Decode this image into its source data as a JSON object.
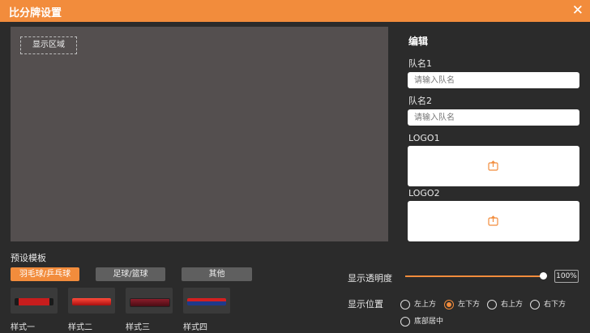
{
  "window": {
    "title": "比分牌设置"
  },
  "preview": {
    "display_area_label": "显示区域"
  },
  "edit": {
    "title": "编辑",
    "team1_label": "队名1",
    "team1_placeholder": "请输入队名",
    "team2_label": "队名2",
    "team2_placeholder": "请输入队名",
    "logo1_label": "LOGO1",
    "logo2_label": "LOGO2"
  },
  "presets": {
    "title": "预设模板",
    "tabs": [
      {
        "label": "羽毛球/乒乓球",
        "active": true
      },
      {
        "label": "足球/篮球",
        "active": false
      },
      {
        "label": "其他",
        "active": false
      }
    ],
    "styles": [
      {
        "label": "样式一"
      },
      {
        "label": "样式二"
      },
      {
        "label": "样式三"
      },
      {
        "label": "样式四"
      }
    ]
  },
  "opacity": {
    "label": "显示透明度",
    "value_text": "100%",
    "value": 1.0
  },
  "position": {
    "label": "显示位置",
    "options": [
      {
        "label": "左上方",
        "checked": false
      },
      {
        "label": "左下方",
        "checked": true
      },
      {
        "label": "右上方",
        "checked": false
      },
      {
        "label": "右下方",
        "checked": false
      },
      {
        "label": "底部居中",
        "checked": false
      }
    ]
  },
  "colors": {
    "accent": "#f28c3c",
    "preview_bg": "#544f4f",
    "window_bg": "#2b2b2b"
  }
}
